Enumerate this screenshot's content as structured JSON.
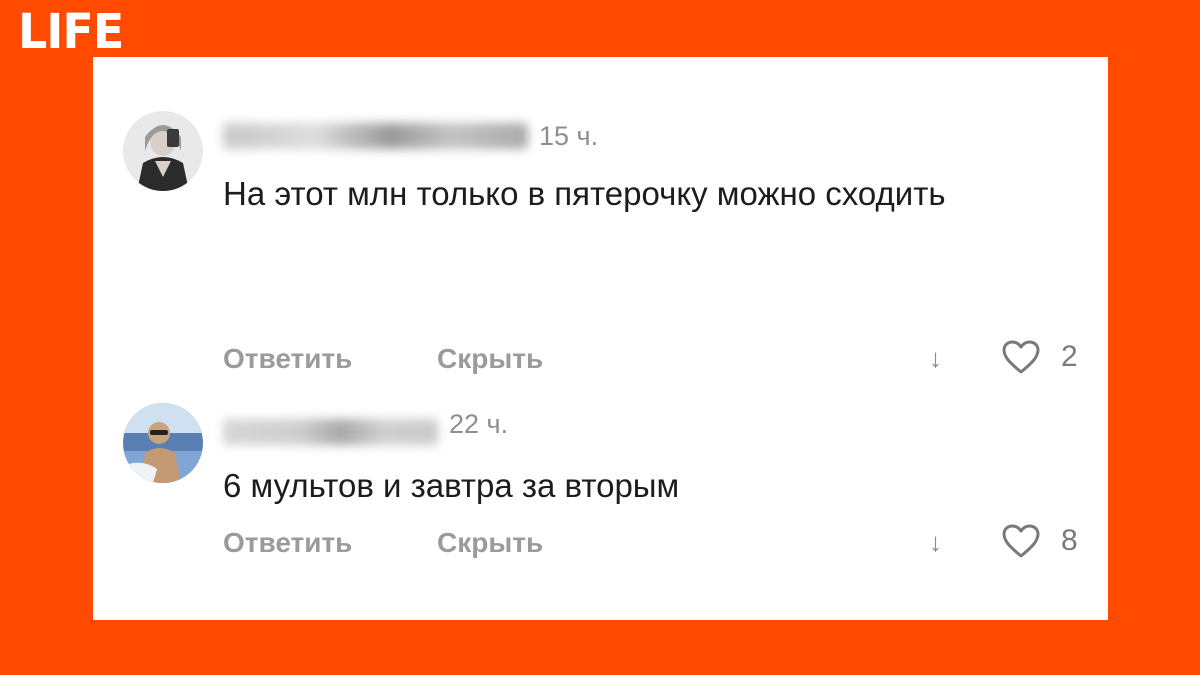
{
  "brand": {
    "logo_text": "LIFE",
    "background_color": "#ff4a00"
  },
  "comments": [
    {
      "avatar_icon": "user-avatar-photo",
      "username": "",
      "time": "15 ч.",
      "text": "На этот млн только в пятерочку можно сходить",
      "reply_label": "Ответить",
      "hide_label": "Скрыть",
      "down_icon": "↓",
      "like_icon": "heart-outline",
      "likes": "2"
    },
    {
      "avatar_icon": "user-avatar-photo",
      "username": "",
      "time": "22 ч.",
      "text": "6 мультов и завтра за вторым",
      "reply_label": "Ответить",
      "hide_label": "Скрыть",
      "down_icon": "↓",
      "like_icon": "heart-outline",
      "likes": "8"
    }
  ]
}
